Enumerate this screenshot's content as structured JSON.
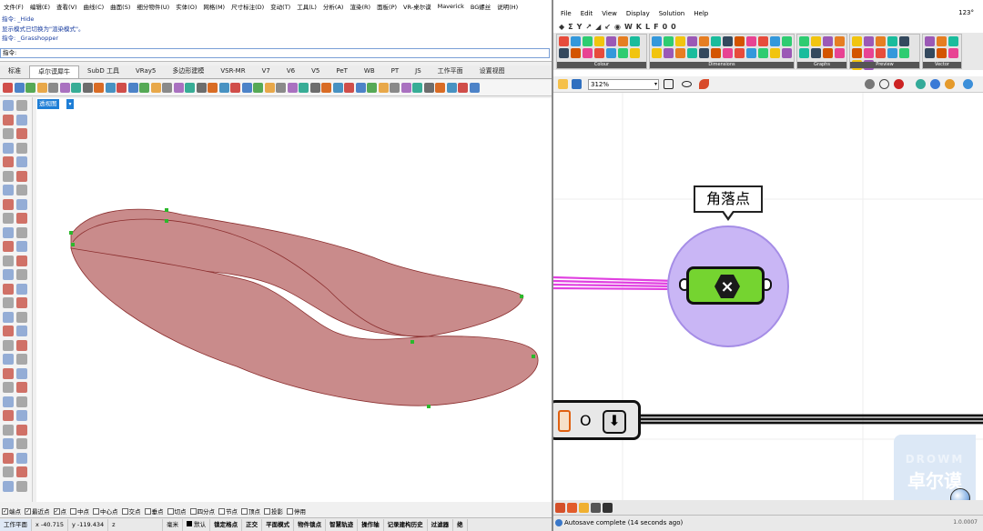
{
  "rhino": {
    "menu": [
      "文件(F)",
      "编辑(E)",
      "查看(V)",
      "曲线(C)",
      "曲面(S)",
      "细分物件(U)",
      "实体(O)",
      "网格(M)",
      "尺寸标注(D)",
      "变动(T)",
      "工具(L)",
      "分析(A)",
      "渲染(R)",
      "面板(P)",
      "VR-桌尔谟",
      "Maverick",
      "BG螺丝",
      "说明(H)"
    ],
    "command_history": [
      "指令: _Hide",
      "显示模式已切换为\"渲染模式\"。",
      "指令: _Grasshopper"
    ],
    "command_prompt": "指令:",
    "tabs": [
      "标准",
      "卓尔谟犀牛",
      "SubD 工具",
      "VRay5",
      "多边形建模",
      "VSR-MR",
      "V7",
      "V6",
      "V5",
      "PeT",
      "WB",
      "PT",
      "JS",
      "工作平面",
      "设置视图"
    ],
    "active_tab_index": 1,
    "viewport_label": "透视图",
    "viewport_menu_arrow": "▾",
    "snaps": [
      {
        "label": "端点",
        "checked": true
      },
      {
        "label": "最近点",
        "checked": true
      },
      {
        "label": "点",
        "checked": true
      },
      {
        "label": "中点",
        "checked": false
      },
      {
        "label": "中心点",
        "checked": false
      },
      {
        "label": "交点",
        "checked": false
      },
      {
        "label": "垂点",
        "checked": false
      },
      {
        "label": "切点",
        "checked": false
      },
      {
        "label": "四分点",
        "checked": false
      },
      {
        "label": "节点",
        "checked": false
      },
      {
        "label": "顶点",
        "checked": false
      },
      {
        "label": "投影",
        "checked": false
      },
      {
        "label": "停用",
        "checked": false
      }
    ],
    "status": {
      "cplane": "工作平面",
      "x": "x -40.715",
      "y": "y -119.434",
      "z": "z",
      "unit": "毫米",
      "layer": "默认",
      "toggles": [
        "锁定格点",
        "正交",
        "平面模式",
        "物件锁点",
        "智慧轨迹",
        "操作轴",
        "记录建构历史",
        "过滤器",
        "绝"
      ]
    }
  },
  "grasshopper": {
    "menu": [
      "File",
      "Edit",
      "View",
      "Display",
      "Solution",
      "Help"
    ],
    "corner_number": "123°",
    "component_tabs": [
      "◆",
      "Σ",
      "Y",
      "↗",
      "◢",
      "↙",
      "◉",
      "W",
      "K",
      "L",
      "F",
      "0",
      "0"
    ],
    "panels": [
      {
        "label": "Colour",
        "width": 100
      },
      {
        "label": "Dimensions",
        "width": 160
      },
      {
        "label": "Graphs",
        "width": 56
      },
      {
        "label": "Preview",
        "width": 78
      },
      {
        "label": "Vector",
        "width": 44
      }
    ],
    "zoom": "312%",
    "zoom_arrow": "▾",
    "bubble_text": "角落点",
    "node_glyph": "×",
    "comp2_letter": "O",
    "comp2_arrow": "⬇",
    "status": "Autosave complete (14 seconds ago)",
    "version": "1.0.0007",
    "watermark_brand": "DROWM",
    "watermark_cn": "卓尔谟"
  },
  "colors": {
    "surface_fill": "#c98b8b",
    "surface_stroke": "#8b2e2e",
    "point_marker": "#2cb82c",
    "wire_magenta": "#e040e0",
    "node_green": "#75d430",
    "group_purple": "#c9b6f5",
    "viewport_tab": "#1e7ed6"
  },
  "icons": [
    "rhino-tool-icon",
    "grasshopper-component-icon",
    "cursor-icon",
    "eye-icon",
    "brush-icon",
    "save-icon",
    "open-icon",
    "gear-icon"
  ]
}
